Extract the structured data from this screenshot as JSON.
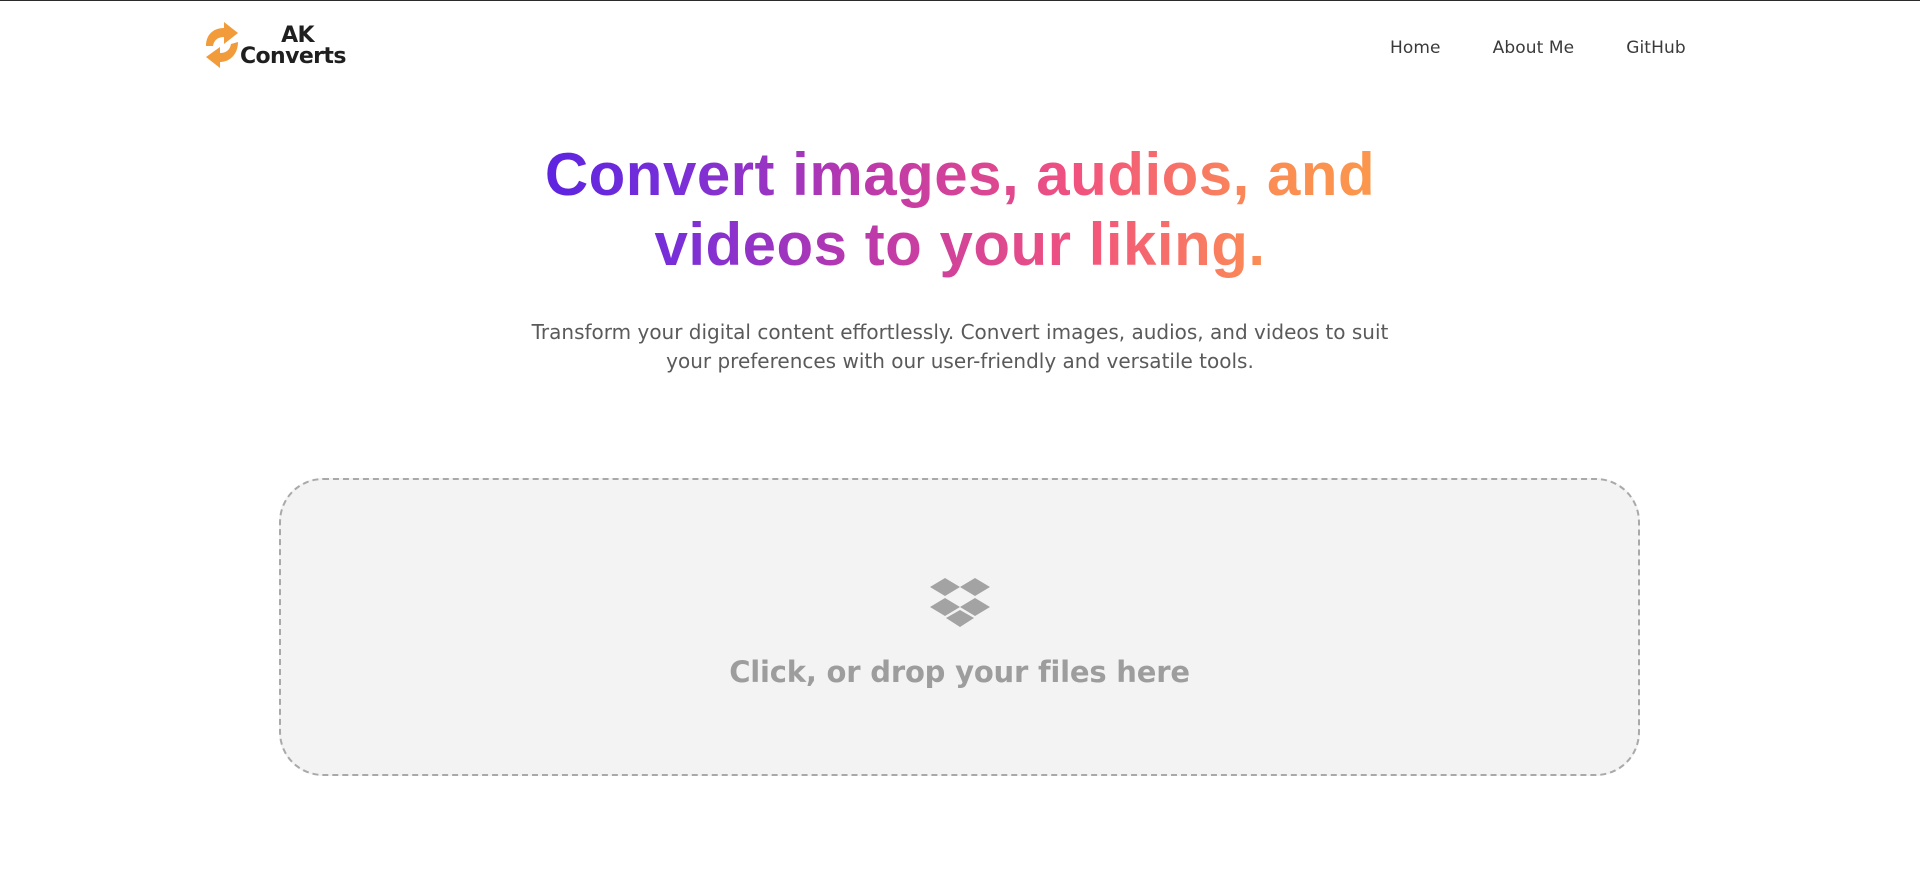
{
  "brand": {
    "line1": "AK",
    "line2": "Converts",
    "icon": "refresh-arrows-icon",
    "accent_color": "#f29b3a"
  },
  "nav": {
    "items": [
      {
        "label": "Home"
      },
      {
        "label": "About Me"
      },
      {
        "label": "GitHub"
      }
    ]
  },
  "hero": {
    "title_line1": "Convert images, audios, and",
    "title_line2": "videos to your liking.",
    "gradient": [
      "#4a1ce6",
      "#c03aa8",
      "#f2527e",
      "#fba044"
    ],
    "subtitle_line1": "Transform your digital content effortlessly. Convert images, audios, and videos to suit",
    "subtitle_line2": "your preferences with our user-friendly and versatile tools."
  },
  "dropzone": {
    "icon": "dropbox-icon",
    "label": "Click, or drop your files here",
    "background": "#f3f3f3",
    "border_color": "#a9a9a9"
  }
}
